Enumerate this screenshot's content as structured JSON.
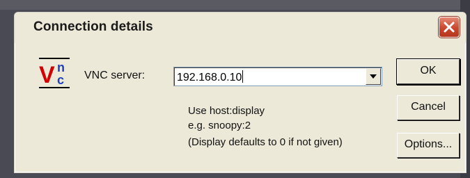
{
  "dialog": {
    "title": "Connection details"
  },
  "logo": {
    "text_top": "V",
    "text_n": "n",
    "text_c": "c",
    "colors": {
      "v": "#d40000",
      "nc": "#1f3fbf"
    }
  },
  "server": {
    "label": "VNC server:",
    "value": "192.168.0.10"
  },
  "hints": {
    "line1": "Use host:display",
    "line2": "e.g. snoopy:2",
    "line3": "(Display defaults to 0 if not given)"
  },
  "buttons": {
    "ok": "OK",
    "cancel": "Cancel",
    "options": "Options..."
  },
  "icons": {
    "close": "close-icon",
    "dropdown": "chevron-down-icon",
    "logo": "vnc-logo"
  }
}
